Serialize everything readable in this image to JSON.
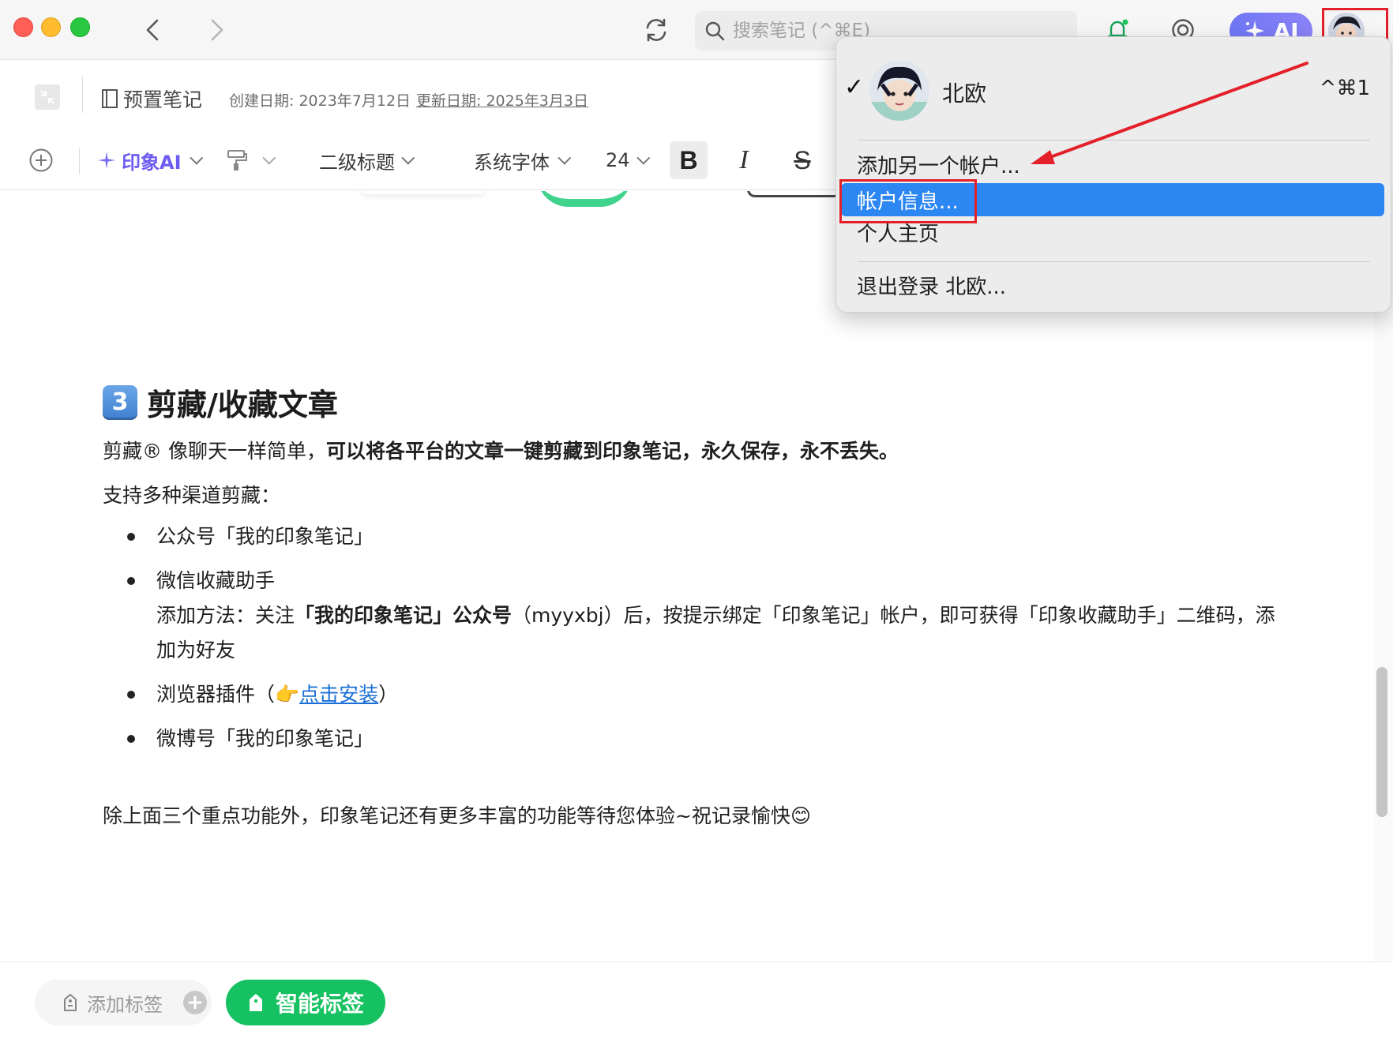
{
  "titlebar": {
    "search_placeholder": "搜索笔记 (^⌘E)",
    "ai_label": "AI",
    "icons": [
      "back-icon",
      "forward-icon",
      "sync-icon",
      "search-icon",
      "bell-icon",
      "smile-icon",
      "sparkle-icon"
    ]
  },
  "note_header": {
    "notebook": "预置笔记",
    "created": "创建日期: 2023年7月12日",
    "updated": "更新日期: 2025年3月3日"
  },
  "toolbar": {
    "ai_tool": "印象AI",
    "heading_style": "二级标题",
    "font_family": "系统字体",
    "font_size": "24",
    "bold": "B",
    "italic": "I",
    "strike": "S"
  },
  "content": {
    "section_number": "3",
    "section_title": "剪藏/收藏文章",
    "intro_plain": "剪藏® 像聊天一样简单，",
    "intro_bold": "可以将各平台的文章一键剪藏到印象笔记，永久保存，永不丢失。",
    "channels_label": "支持多种渠道剪藏：",
    "list": {
      "item1": "公众号「我的印象笔记」",
      "item2_title": "微信收藏助手",
      "item2_desc_pre": "添加方法：关注",
      "item2_desc_bold": "「我的印象笔记」公众号",
      "item2_desc_post": "（myyxbj）后，按提示绑定「印象笔记」帐户，即可获得「印象收藏助手」二维码，添加为好友",
      "item3_pre": "浏览器插件（",
      "item3_emoji": "👉",
      "item3_link": "点击安装",
      "item3_post": "）",
      "item4": "微博号「我的印象笔记」"
    },
    "closing_text": "除上面三个重点功能外，印象笔记还有更多丰富的功能等待您体验~祝记录愉快",
    "closing_emoji": "😊"
  },
  "bottom_bar": {
    "add_tag_placeholder": "添加标签",
    "smart_tag_label": "智能标签"
  },
  "account_menu": {
    "current_user": "北欧",
    "current_user_shortcut": "^⌘1",
    "items": [
      "添加另一个帐户...",
      "帐户信息...",
      "个人主页",
      "退出登录 北欧..."
    ],
    "selected_item": "帐户信息..."
  },
  "colors": {
    "accent_ai": "#6f76f5",
    "smart_tag_green": "#15c160",
    "menu_selection": "#2d87f2",
    "annotation_red": "#e3202a",
    "link_blue": "#1a6fd6"
  }
}
